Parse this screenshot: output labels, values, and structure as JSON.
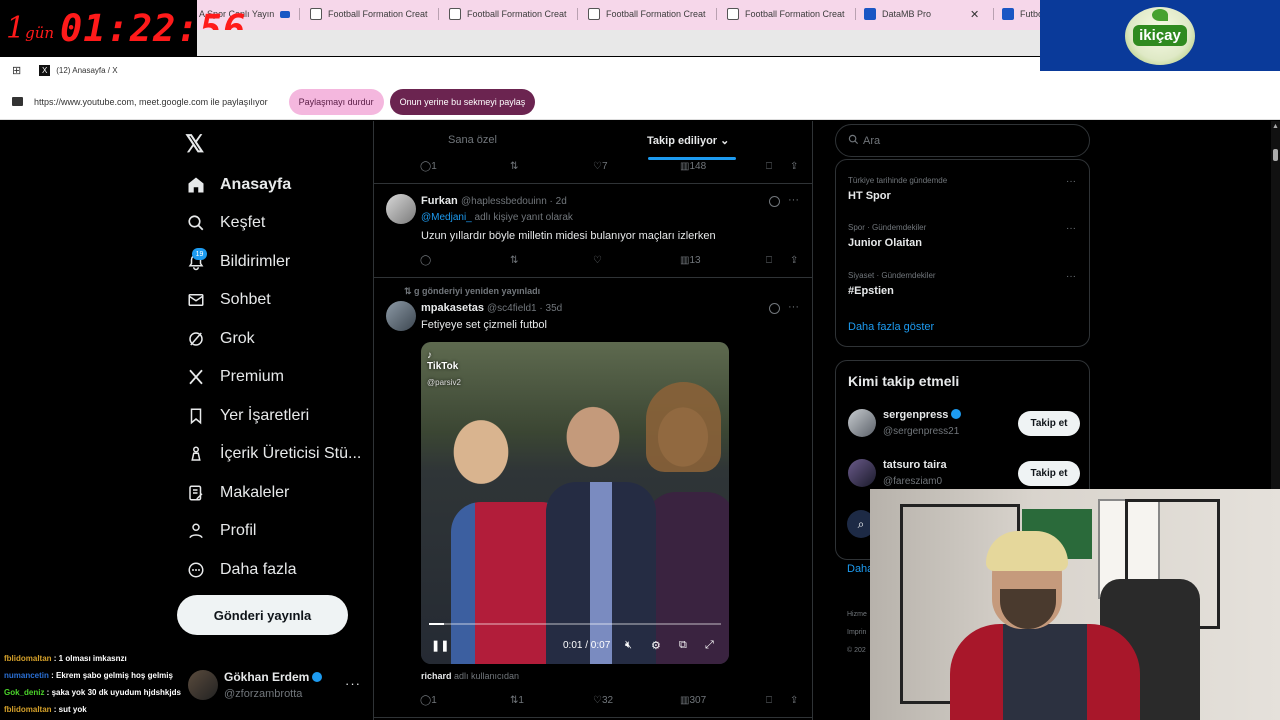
{
  "browser": {
    "timer": {
      "days_num": "1",
      "days_label": "gün",
      "clock": "01:22:56"
    },
    "tabs": [
      {
        "label": "A Spor Canlı Yayın"
      },
      {
        "label": "Football Formation Creat"
      },
      {
        "label": "Football Formation Creat"
      },
      {
        "label": "Football Formation Creat"
      },
      {
        "label": "Football Formation Creat"
      },
      {
        "label": "DataMB Pro"
      },
      {
        "label": "Futbol"
      }
    ],
    "window_title": "(12) Anasayfa / X",
    "share_text": "https://www.youtube.com, meet.google.com ile paylaşılıyor",
    "stop_share": "Paylaşmayı durdur",
    "share_this_tab": "Onun yerine bu sekmeyi paylaş",
    "sponsor": "ikiçay",
    "colors": {
      "tabbar": "#f6d7ea",
      "stop_share": "#f4b7de",
      "share_tab": "#6b2450",
      "accent": "#1d9bf0"
    }
  },
  "nav": {
    "logo": "𝕏",
    "notifications_badge": "19",
    "items": [
      {
        "label": "Anasayfa",
        "icon": "home-icon"
      },
      {
        "label": "Keşfet",
        "icon": "search-icon"
      },
      {
        "label": "Bildirimler",
        "icon": "bell-icon"
      },
      {
        "label": "Sohbet",
        "icon": "mail-icon"
      },
      {
        "label": "Grok",
        "icon": "grok-icon"
      },
      {
        "label": "Premium",
        "icon": "x-icon"
      },
      {
        "label": "Yer İşaretleri",
        "icon": "bookmark-icon"
      },
      {
        "label": "İçerik Üreticisi Stü...",
        "icon": "creator-icon"
      },
      {
        "label": "Makaleler",
        "icon": "article-icon"
      },
      {
        "label": "Profil",
        "icon": "person-icon"
      },
      {
        "label": "Daha fazla",
        "icon": "more-circle-icon"
      }
    ],
    "post_button": "Gönderi yayınla",
    "account": {
      "name": "Gökhan Erdem",
      "handle": "@zforzambrotta"
    }
  },
  "chat": [
    {
      "user": "fblidomaltan",
      "msg": " : 1 olması imkasnzı",
      "color": "#d4a02a"
    },
    {
      "user": "numancetin",
      "msg": " : Ekrem şabo gelmiş hoş gelmiş",
      "color": "#2a6fd4"
    },
    {
      "user": "Gok_deniz",
      "msg": " : şaka yok 30 dk uyudum hjdshkjds",
      "color": "#4bd42a"
    },
    {
      "user": "fblidomaltan",
      "msg": " : sut yok",
      "color": "#d4a02a"
    }
  ],
  "timeline": {
    "tabs": {
      "for_you": "Sana özel",
      "following": "Takip ediliyor"
    },
    "top_actions": {
      "replies": "1",
      "retweets": "",
      "likes": "7",
      "views": "148"
    },
    "post1": {
      "name": "Furkan",
      "handle": "@haplessbedouinn · 2d",
      "reply_prefix": "@Medjani_",
      "reply_suffix": " adlı kişiye yanıt olarak",
      "text": "Uzun yıllardır böyle milletin midesi bulanıyor maçları izlerken",
      "actions": {
        "replies": "",
        "retweets": "",
        "likes": "",
        "views": "13"
      }
    },
    "post2": {
      "repost_label": "g gönderiyi yeniden yayınladı",
      "name": "mpakasetas",
      "handle": "@sc4field1 · 35d",
      "text": "Fetiyeye set çizmeli futbol",
      "video": {
        "watermark": "TikTok",
        "watermark_user": "@parsiv2",
        "time": "0:01 / 0:07",
        "progress": 0.05
      },
      "from_label": "richard",
      "from_suffix": " adlı kullanıcıdan",
      "actions": {
        "replies": "1",
        "retweets": "1",
        "likes": "32",
        "views": "307"
      }
    }
  },
  "sidebar": {
    "search_placeholder": "Ara",
    "trends": [
      {
        "context": "Türkiye tarihinde gündemde",
        "title": "HT Spor"
      },
      {
        "context": "Spor · Gündemdekiler",
        "title": "Junior Olaitan"
      },
      {
        "context": "Siyaset · Gündemdekiler",
        "title": "#Epstien"
      }
    ],
    "show_more": "Daha fazla göster",
    "who_to_follow": {
      "title": "Kimi takip etmeli",
      "users": [
        {
          "name": "sergenpress",
          "handle": "@sergenpress21",
          "button": "Takip et"
        },
        {
          "name": "tatsuro taira",
          "handle": "@faresziam0",
          "button": "Takip et"
        }
      ]
    },
    "partial_link": "Daha",
    "partial_footer": [
      "Hizme",
      "Imprin",
      "© 202"
    ]
  }
}
